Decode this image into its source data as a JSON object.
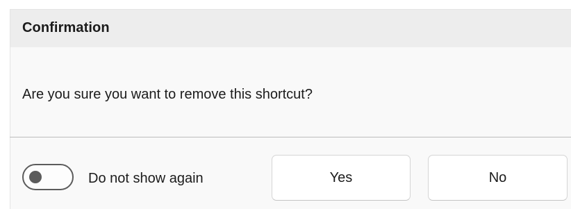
{
  "dialog": {
    "title": "Confirmation",
    "message": "Are you sure you want to remove this shortcut?",
    "toggle": {
      "label": "Do not show again",
      "checked": false
    },
    "buttons": {
      "yes_label": "Yes",
      "no_label": "No"
    }
  }
}
